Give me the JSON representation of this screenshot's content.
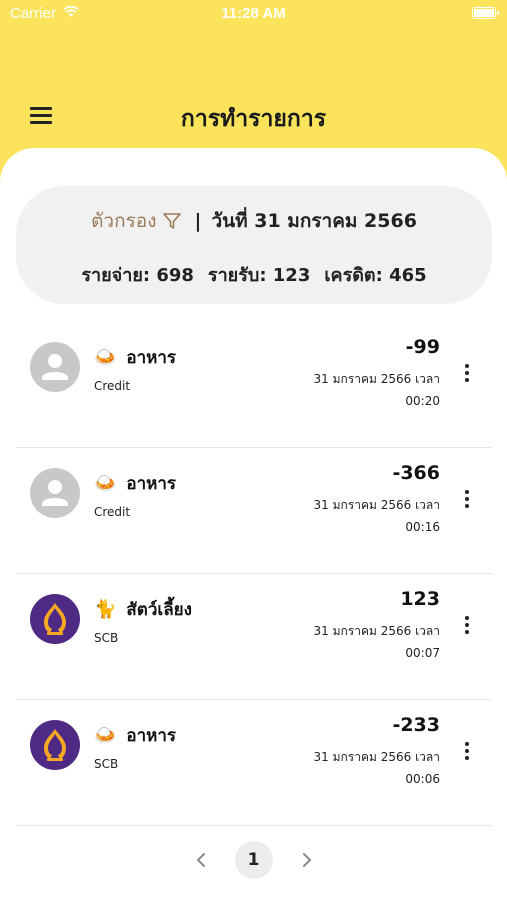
{
  "status_bar": {
    "carrier": "Carrier",
    "time": "11:28 AM",
    "icons": [
      "wifi-icon",
      "battery-icon"
    ]
  },
  "header": {
    "title": "การทำรายการ",
    "menu_icon": "hamburger-menu-icon",
    "background_color": "#fbe45c"
  },
  "summary": {
    "filter_label": "ตัวกรอง",
    "filter_icon": "filter-funnel-icon",
    "divider": "|",
    "date_label": "วันที่ 31 มกราคม 2566",
    "expense_label": "รายจ่าย: 698",
    "income_label": "รายรับ: 123",
    "credit_label": "เครดิต: 465",
    "filter_color": "#9a7b5c"
  },
  "transactions": [
    {
      "category": "อาหาร",
      "category_icon": "🍛",
      "account": "Credit",
      "avatar": "default-user-avatar",
      "amount": "-99",
      "date": "31 มกราคม 2566 เวลา",
      "time": "00:20"
    },
    {
      "category": "อาหาร",
      "category_icon": "🍛",
      "account": "Credit",
      "avatar": "default-user-avatar",
      "amount": "-366",
      "date": "31 มกราคม 2566 เวลา",
      "time": "00:16"
    },
    {
      "category": "สัตว์เลี้ยง",
      "category_icon": "🐈",
      "account": "SCB",
      "avatar": "scb-bank-logo",
      "amount": "123",
      "date": "31 มกราคม 2566 เวลา",
      "time": "00:07"
    },
    {
      "category": "อาหาร",
      "category_icon": "🍛",
      "account": "SCB",
      "avatar": "scb-bank-logo",
      "amount": "-233",
      "date": "31 มกราคม 2566 เวลา",
      "time": "00:06"
    }
  ],
  "pagination": {
    "current_page": "1",
    "prev_icon": "chevron-left-icon",
    "next_icon": "chevron-right-icon"
  },
  "colors": {
    "scb_purple": "#4e2a84",
    "scb_gold": "#f6a823",
    "avatar_gray": "#c8c8c8"
  }
}
